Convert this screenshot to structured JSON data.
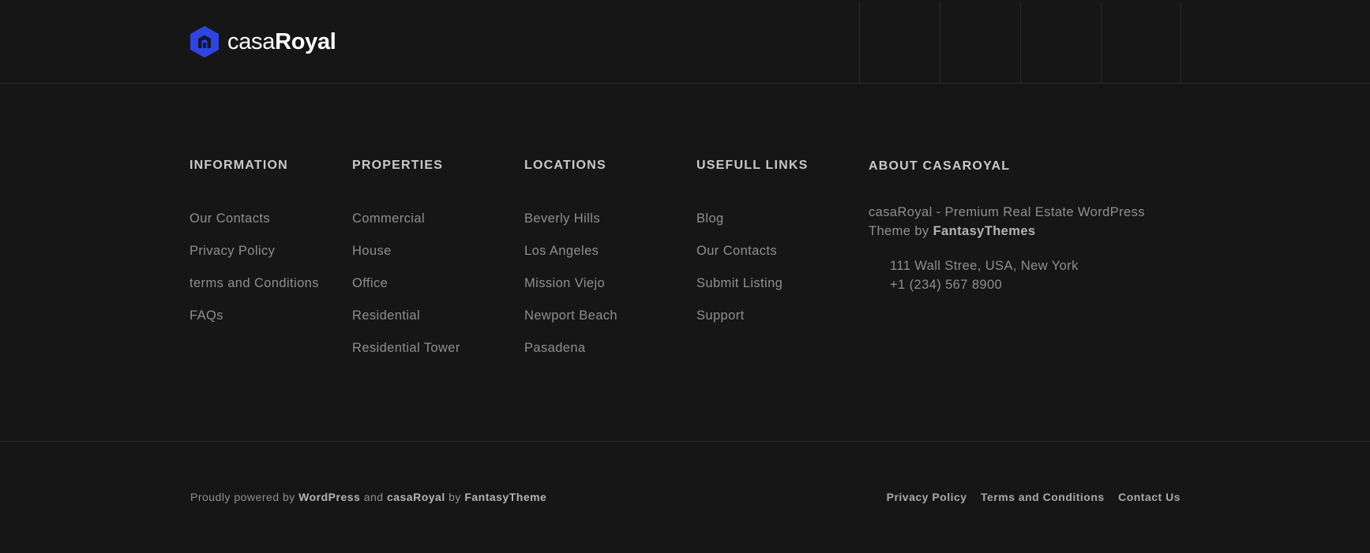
{
  "brand": {
    "name_light": "casa",
    "name_bold": "Royal",
    "logo_color": "#3045e0"
  },
  "columns": [
    {
      "title": "INFORMATION",
      "items": [
        "Our Contacts",
        "Privacy Policy",
        "terms and Conditions",
        "FAQs"
      ]
    },
    {
      "title": "PROPERTIES",
      "items": [
        "Commercial",
        "House",
        "Office",
        "Residential",
        "Residential Tower"
      ]
    },
    {
      "title": "LOCATIONS",
      "items": [
        "Beverly Hills",
        "Los Angeles",
        "Mission Viejo",
        "Newport Beach",
        "Pasadena"
      ]
    },
    {
      "title": "USEFULL LINKS",
      "items": [
        "Blog",
        "Our Contacts",
        "Submit Listing",
        "Support"
      ]
    }
  ],
  "about": {
    "title": "ABOUT CASAROYAL",
    "text": "casaRoyal - Premium Real Estate WordPress Theme by ",
    "link": "FantasyThemes",
    "address": "111 Wall Stree, USA, New York",
    "phone": "+1 (234) 567 8900"
  },
  "credits": {
    "prefix": "Proudly powered by ",
    "wordpress": "WordPress",
    "and": " and ",
    "theme": "casaRoyal",
    "by": " by ",
    "author": "FantasyTheme"
  },
  "bottom_links": [
    "Privacy Policy",
    "Terms and Conditions",
    "Contact Us"
  ]
}
